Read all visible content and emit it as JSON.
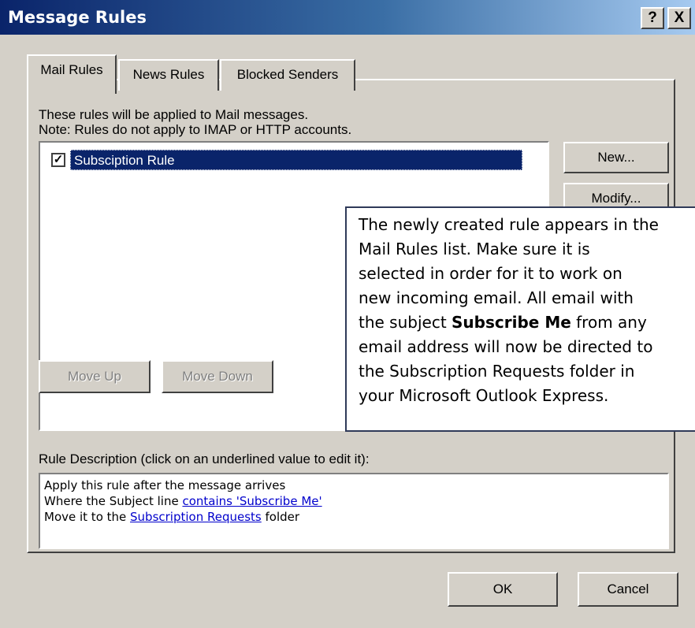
{
  "window": {
    "title": "Message Rules",
    "help_label": "?",
    "close_label": "X"
  },
  "tabs": [
    {
      "label": "Mail Rules",
      "active": true
    },
    {
      "label": "News Rules",
      "active": false
    },
    {
      "label": "Blocked Senders",
      "active": false
    }
  ],
  "mail_rules": {
    "info_line1": "These rules will be applied to Mail messages.",
    "info_line2": "Note: Rules do not apply to IMAP or HTTP accounts.",
    "rules": [
      {
        "label": "Subsciption Rule",
        "checked": true,
        "selected": true
      }
    ],
    "buttons": {
      "new": "New...",
      "modify": "Modify...",
      "move_up": "Move Up",
      "move_down": "Move Down"
    },
    "description_label": "Rule Description (click on an underlined value to edit it):",
    "description": {
      "line1": "Apply this rule after the message arrives",
      "line2_prefix": "Where the Subject line ",
      "line2_link": "contains 'Subscribe Me'",
      "line3_prefix": "Move it to the ",
      "line3_link": "Subscription Requests",
      "line3_suffix": " folder"
    }
  },
  "footer": {
    "ok": "OK",
    "cancel": "Cancel"
  },
  "callout": {
    "line1": "The newly created rule appears in the",
    "line2": "Mail Rules list. Make sure it is",
    "line3": "selected in order for it to work on",
    "line4": "new incoming email. All email with",
    "line5_prefix": "the subject ",
    "line5_bold": "Subscribe Me",
    "line5_suffix": " from any",
    "line6": "email address will now be directed to",
    "line7": "the Subscription Requests folder in",
    "line8": "your Microsoft Outlook Express."
  },
  "colors": {
    "title_gradient_start": "#0a246a",
    "title_gradient_end": "#a6caf0",
    "dialog_face": "#d4d0c8",
    "selection": "#0a246a",
    "link": "#0000cc"
  }
}
